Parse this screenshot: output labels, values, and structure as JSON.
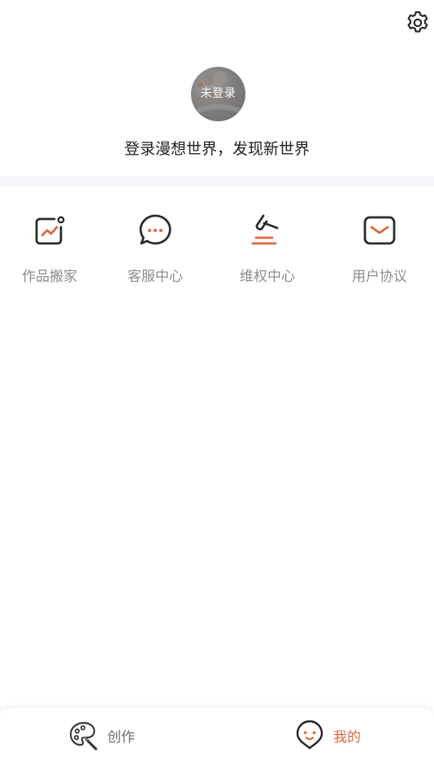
{
  "header": {
    "settings_icon": "gear-icon"
  },
  "profile": {
    "avatar_label": "未登录",
    "login_prompt": "登录漫想世界，发现新世界"
  },
  "quick_actions": [
    {
      "label": "作品搬家",
      "icon": "chart-card-icon"
    },
    {
      "label": "客服中心",
      "icon": "chat-bubble-icon"
    },
    {
      "label": "维权中心",
      "icon": "gavel-icon"
    },
    {
      "label": "用户协议",
      "icon": "mail-icon"
    }
  ],
  "tabbar": {
    "create": {
      "label": "创作",
      "icon": "palette-icon"
    },
    "mine": {
      "label": "我的",
      "icon": "face-pin-icon",
      "active": true
    }
  },
  "colors": {
    "accent": "#e0673e",
    "icon_stroke": "#2b2b2b",
    "label_gray": "#8c8c8c",
    "divider": "#f5f6fa"
  }
}
